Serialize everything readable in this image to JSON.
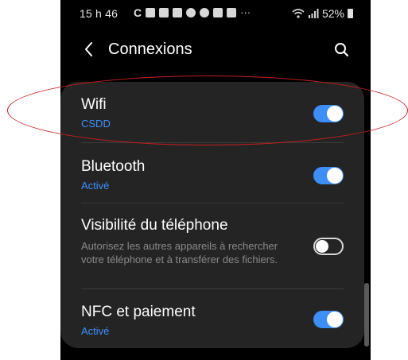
{
  "status_bar": {
    "time": "15 h 46",
    "notification_icons": [
      "c-icon",
      "mail-icon",
      "mail-icon",
      "mail-icon",
      "person-icon",
      "cloud-icon",
      "image-icon",
      "download-icon"
    ],
    "more": "···",
    "battery_text": "52%"
  },
  "header": {
    "title": "Connexions"
  },
  "settings": [
    {
      "label": "Wifi",
      "sub": "CSDD",
      "toggle": true
    },
    {
      "label": "Bluetooth",
      "sub": "Activé",
      "toggle": true
    },
    {
      "label": "Visibilité du téléphone",
      "desc": "Autorisez les autres appareils à rechercher votre téléphone et à transférer des fichiers.",
      "toggle": false
    },
    {
      "label": "NFC et paiement",
      "sub": "Activé",
      "toggle": true
    }
  ],
  "colors": {
    "accent": "#3e8ef7",
    "card": "#242424",
    "annotation": "#c81e1e"
  }
}
